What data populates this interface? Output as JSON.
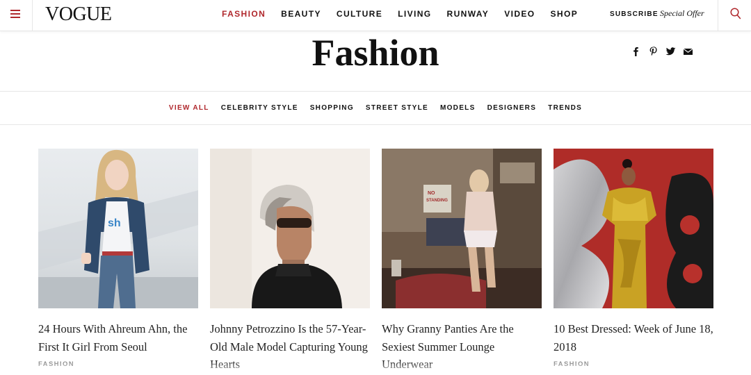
{
  "brand": {
    "logo": "VOGUE",
    "accent": "#b0282d"
  },
  "nav": {
    "items": [
      {
        "label": "FASHION",
        "active": true
      },
      {
        "label": "BEAUTY"
      },
      {
        "label": "CULTURE"
      },
      {
        "label": "LIVING"
      },
      {
        "label": "RUNWAY"
      },
      {
        "label": "VIDEO"
      },
      {
        "label": "SHOP"
      }
    ],
    "subscribe": "SUBSCRIBE",
    "special_offer": "Special Offer",
    "menu_icon": "hamburger-icon",
    "search_icon": "search-icon"
  },
  "page": {
    "title": "Fashion"
  },
  "share": [
    "facebook-icon",
    "pinterest-icon",
    "twitter-icon",
    "email-icon"
  ],
  "subnav": {
    "items": [
      {
        "label": "VIEW ALL",
        "active": true
      },
      {
        "label": "CELEBRITY STYLE"
      },
      {
        "label": "SHOPPING"
      },
      {
        "label": "STREET STYLE"
      },
      {
        "label": "MODELS"
      },
      {
        "label": "DESIGNERS"
      },
      {
        "label": "TRENDS"
      }
    ]
  },
  "articles": [
    {
      "headline": "24 Hours With Ahreum Ahn, the First It Girl From Seoul",
      "tag": "FASHION"
    },
    {
      "headline": "Johnny Petrozzino Is the 57-Year-Old Male Model Capturing Young Hearts",
      "tag": ""
    },
    {
      "headline": "Why Granny Panties Are the Sexiest Summer Lounge Underwear",
      "tag": ""
    },
    {
      "headline": "10 Best Dressed: Week of June 18, 2018",
      "tag": "FASHION"
    }
  ]
}
